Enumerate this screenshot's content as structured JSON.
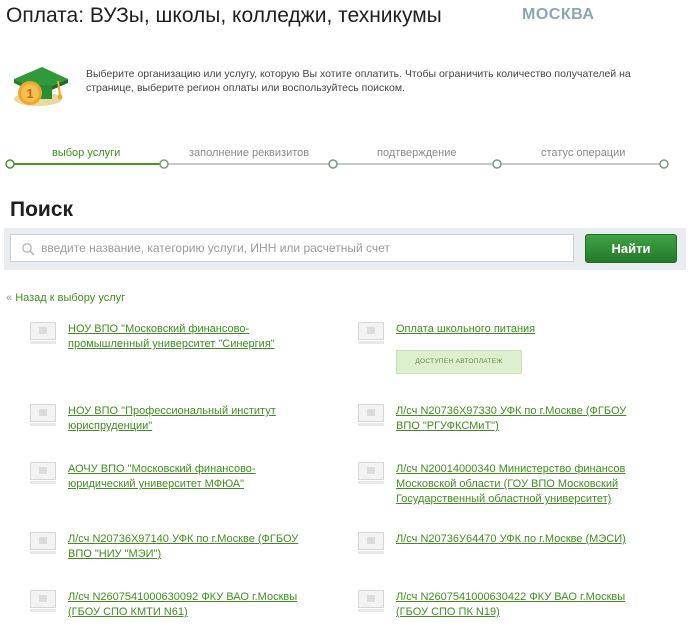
{
  "header": {
    "title": "Оплата: ВУЗы, школы, колледжи, техникумы",
    "region": "МОСКВА"
  },
  "intro": {
    "text": "Выберите организацию или услугу, которую Вы хотите оплатить. Чтобы ограничить количество получателей на странице, выберите регион оплаты или воспользуйтесь поиском."
  },
  "steps": [
    {
      "label": "выбор услуги",
      "active": true
    },
    {
      "label": "заполнение реквизитов",
      "active": false
    },
    {
      "label": "подтверждение",
      "active": false
    },
    {
      "label": "статус операции",
      "active": false
    }
  ],
  "search": {
    "heading": "Поиск",
    "placeholder": "введите название, категорию услуги, ИНН или расчетный счет",
    "button_label": "Найти"
  },
  "back_link": {
    "arrow": "«",
    "label": "Назад к выбору услуг"
  },
  "items_left": [
    {
      "line1": "НОУ ВПО \"Московский финансово-",
      "line2": "промышленный университет \"Синергия\""
    },
    {
      "line1": "НОУ ВПО \"Профессиональный институт",
      "line2": "юриспруденции\""
    },
    {
      "line1": "АОЧУ ВПО \"Московский финансово-",
      "line2": "юридический университет МФЮА\""
    },
    {
      "line1": "Л/сч N20736X97140 УФК по г.Москве (ФГБОУ",
      "line2": "ВПО \"НИУ \"МЭИ\")"
    },
    {
      "line1": "Л/сч N2607541000630092 ФКУ ВАО г.Москвы",
      "line2": "(ГБОУ СПО КМТИ N61)"
    }
  ],
  "items_right": [
    {
      "line1": "Оплата школьного питания",
      "line2": ""
    },
    {
      "line1": "Л/сч N20736X97330 УФК по г.Москве (ФГБОУ",
      "line2": "ВПО \"РГУФКСМиТ\")"
    },
    {
      "line1": "Л/сч N20014000340 Министерство финансов",
      "line2": "Московской области (ГОУ ВПО Московский",
      "line3": "Государственный областной университет)"
    },
    {
      "line1": "Л/сч N20736У64470 УФК по г.Москве (МЭСИ)",
      "line2": ""
    },
    {
      "line1": "Л/сч N2607541000630422 ФКУ ВАО г.Москвы",
      "line2": "(ГБОУ СПО ПК N19)"
    }
  ],
  "autopay_badge": "ДОСТУПЕН АВТОПЛАТЕЖ"
}
